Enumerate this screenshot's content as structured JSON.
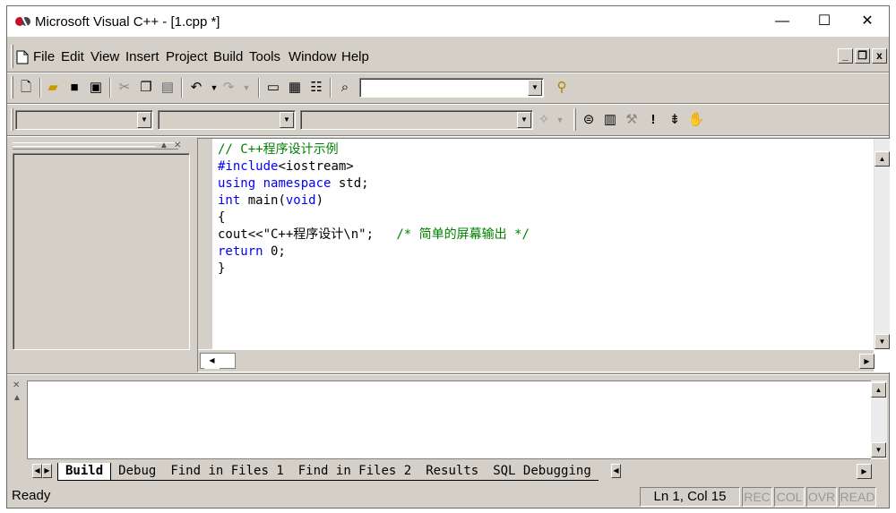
{
  "window": {
    "title": "Microsoft Visual C++ - [1.cpp *]",
    "caption_minimize": "—",
    "caption_maximize": "☐",
    "caption_close": "✕"
  },
  "menu": {
    "items": [
      "File",
      "Edit",
      "View",
      "Insert",
      "Project",
      "Build",
      "Tools",
      "Window",
      "Help"
    ],
    "mdi_min": "_",
    "mdi_restore": "❐",
    "mdi_close": "x"
  },
  "editor": {
    "lines": [
      "// C++程序设计示例",
      "#include<iostream>",
      "using namespace std;",
      "int main(void)",
      "{",
      "cout<<\"C++程序设计\\n\";",
      "/* 简单的屏幕输出 */",
      "return 0;",
      "}"
    ],
    "keywords": [
      "using",
      "namespace",
      "int",
      "void",
      "return",
      "#include"
    ]
  },
  "output": {
    "tabs": [
      "Build",
      "Debug",
      "Find in Files 1",
      "Find in Files 2",
      "Results",
      "SQL Debugging"
    ],
    "active_tab": "Build"
  },
  "status": {
    "text": "Ready",
    "position": "Ln 1, Col 15",
    "indicators": [
      "REC",
      "COL",
      "OVR",
      "READ"
    ]
  },
  "colors": {
    "keyword": "#0000ff",
    "comment": "#008000",
    "chrome": "#d4d0c8"
  }
}
